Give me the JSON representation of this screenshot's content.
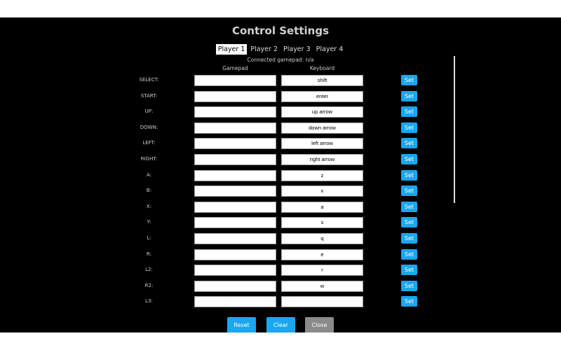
{
  "title": "Control Settings",
  "tabs": [
    {
      "label": "Player 1",
      "active": true
    },
    {
      "label": "Player 2"
    },
    {
      "label": "Player 3"
    },
    {
      "label": "Player 4"
    }
  ],
  "connected": "Connected gamepad: n/a",
  "headers": {
    "gamepad": "Gamepad",
    "keyboard": "Keyboard"
  },
  "set_label": "Set",
  "rows": [
    {
      "label": "SELECT:",
      "gamepad": "",
      "keyboard": "shift"
    },
    {
      "label": "START:",
      "gamepad": "",
      "keyboard": "enter"
    },
    {
      "label": "UP:",
      "gamepad": "",
      "keyboard": "up arrow"
    },
    {
      "label": "DOWN:",
      "gamepad": "",
      "keyboard": "down arrow"
    },
    {
      "label": "LEFT:",
      "gamepad": "",
      "keyboard": "left arrow"
    },
    {
      "label": "RIGHT:",
      "gamepad": "",
      "keyboard": "right arrow"
    },
    {
      "label": "A:",
      "gamepad": "",
      "keyboard": "z"
    },
    {
      "label": "B:",
      "gamepad": "",
      "keyboard": "x"
    },
    {
      "label": "X:",
      "gamepad": "",
      "keyboard": "a"
    },
    {
      "label": "Y:",
      "gamepad": "",
      "keyboard": "s"
    },
    {
      "label": "L:",
      "gamepad": "",
      "keyboard": "q"
    },
    {
      "label": "R:",
      "gamepad": "",
      "keyboard": "e"
    },
    {
      "label": "L2:",
      "gamepad": "",
      "keyboard": "r"
    },
    {
      "label": "R2:",
      "gamepad": "",
      "keyboard": "w"
    },
    {
      "label": "L3:",
      "gamepad": "",
      "keyboard": ""
    },
    {
      "label": "",
      "gamepad": "",
      "keyboard": ""
    }
  ],
  "buttons": {
    "reset": "Reset",
    "clear": "Clear",
    "close": "Close"
  },
  "colors": {
    "accent": "#1aa7ef",
    "close": "#8a8a8a"
  }
}
